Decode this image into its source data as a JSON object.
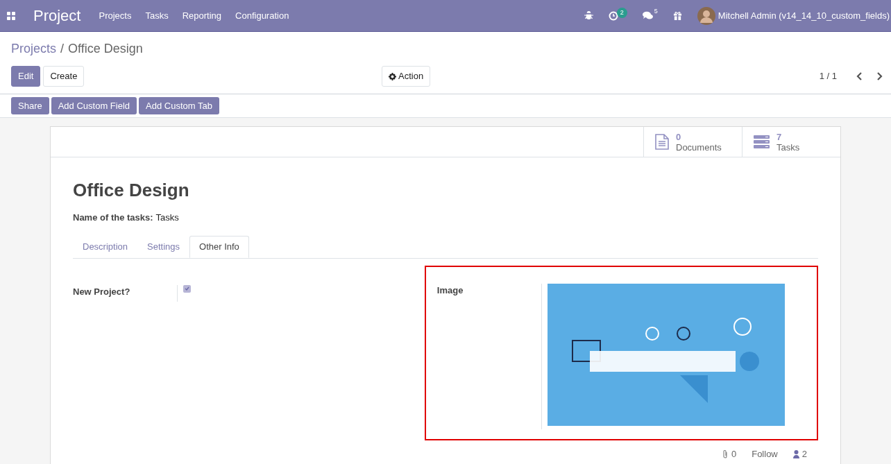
{
  "navbar": {
    "app_title": "Project",
    "menu": [
      {
        "label": "Projects"
      },
      {
        "label": "Tasks"
      },
      {
        "label": "Reporting"
      },
      {
        "label": "Configuration"
      }
    ],
    "activity_count": "2",
    "message_count": "5",
    "user": "Mitchell Admin (v14_14_10_custom_fields)"
  },
  "breadcrumb_separator": "/",
  "breadcrumb": [
    {
      "label": "Projects",
      "kind": "link"
    },
    {
      "label": "Office Design",
      "kind": "current"
    }
  ],
  "buttons": [
    {
      "label": "Edit",
      "kind": "primary"
    },
    {
      "label": "Create",
      "kind": "secondary"
    }
  ],
  "action_button": "Action",
  "pager": "1 / 1",
  "custom_buttons": [
    "Share",
    "Add Custom Field",
    "Add Custom Tab"
  ],
  "smart_buttons": [
    {
      "kind": "document",
      "count": "0",
      "label": "Documents"
    },
    {
      "kind": "list",
      "count": "7",
      "label": "Tasks"
    }
  ],
  "record": {
    "title": "Office Design",
    "task_name_label": "Name of the tasks:",
    "task_name": "Tasks"
  },
  "tabs": [
    {
      "label": "Description",
      "selected": false
    },
    {
      "label": "Settings",
      "selected": false
    },
    {
      "label": "Other Info",
      "selected": true
    }
  ],
  "fields": {
    "new_project": {
      "label": "New Project?",
      "checked": true
    },
    "image": {
      "label": "Image",
      "highlighted": true
    }
  },
  "chatter": {
    "attachments": "0",
    "follow": "Follow",
    "followers": "2"
  }
}
